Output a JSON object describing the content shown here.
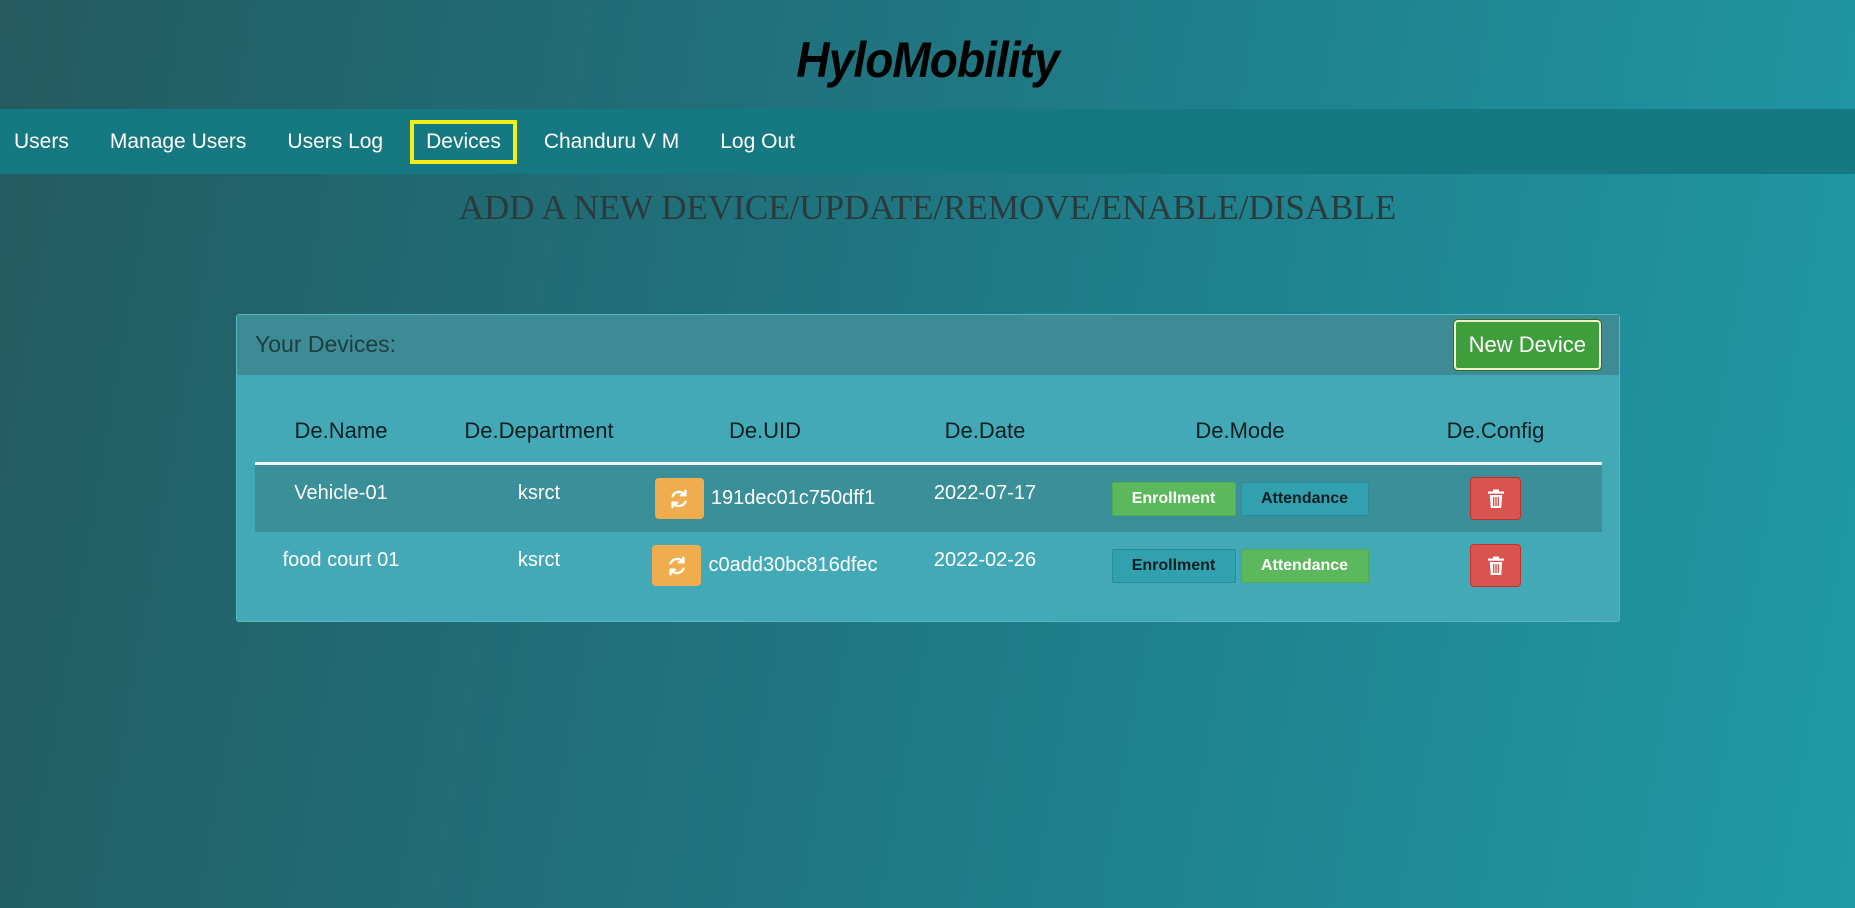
{
  "brand": {
    "title": "HyloMobility"
  },
  "nav": {
    "items": [
      {
        "label": "Users",
        "active": false
      },
      {
        "label": "Manage Users",
        "active": false
      },
      {
        "label": "Users Log",
        "active": false
      },
      {
        "label": "Devices",
        "active": true
      },
      {
        "label": "Chanduru V M",
        "active": false
      },
      {
        "label": "Log Out",
        "active": false
      }
    ]
  },
  "page": {
    "heading": "ADD A NEW DEVICE/UPDATE/REMOVE/ENABLE/DISABLE"
  },
  "panel": {
    "title": "Your Devices:",
    "new_device_label": "New Device",
    "columns": [
      "De.Name",
      "De.Department",
      "De.UID",
      "De.Date",
      "De.Mode",
      "De.Config"
    ],
    "rows": [
      {
        "name": "Vehicle-01",
        "department": "ksrct",
        "uid": "191dec01c750dff1",
        "date": "2022-07-17",
        "mode": "Enrollment"
      },
      {
        "name": "food court 01",
        "department": "ksrct",
        "uid": "c0add30bc816dfec",
        "date": "2022-02-26",
        "mode": "Attendance"
      }
    ],
    "mode_labels": {
      "enrollment": "Enrollment",
      "attendance": "Attendance"
    }
  },
  "icons": {
    "refresh": "refresh-icon",
    "delete": "trash-icon"
  },
  "colors": {
    "navbar": "#167880",
    "active_outline": "#f2ee1a",
    "new_device": "#3f9e3c",
    "mode_on": "#5cb85c",
    "mode_off": "#31a1b0",
    "refresh": "#efad4d",
    "delete": "#d9534f"
  }
}
